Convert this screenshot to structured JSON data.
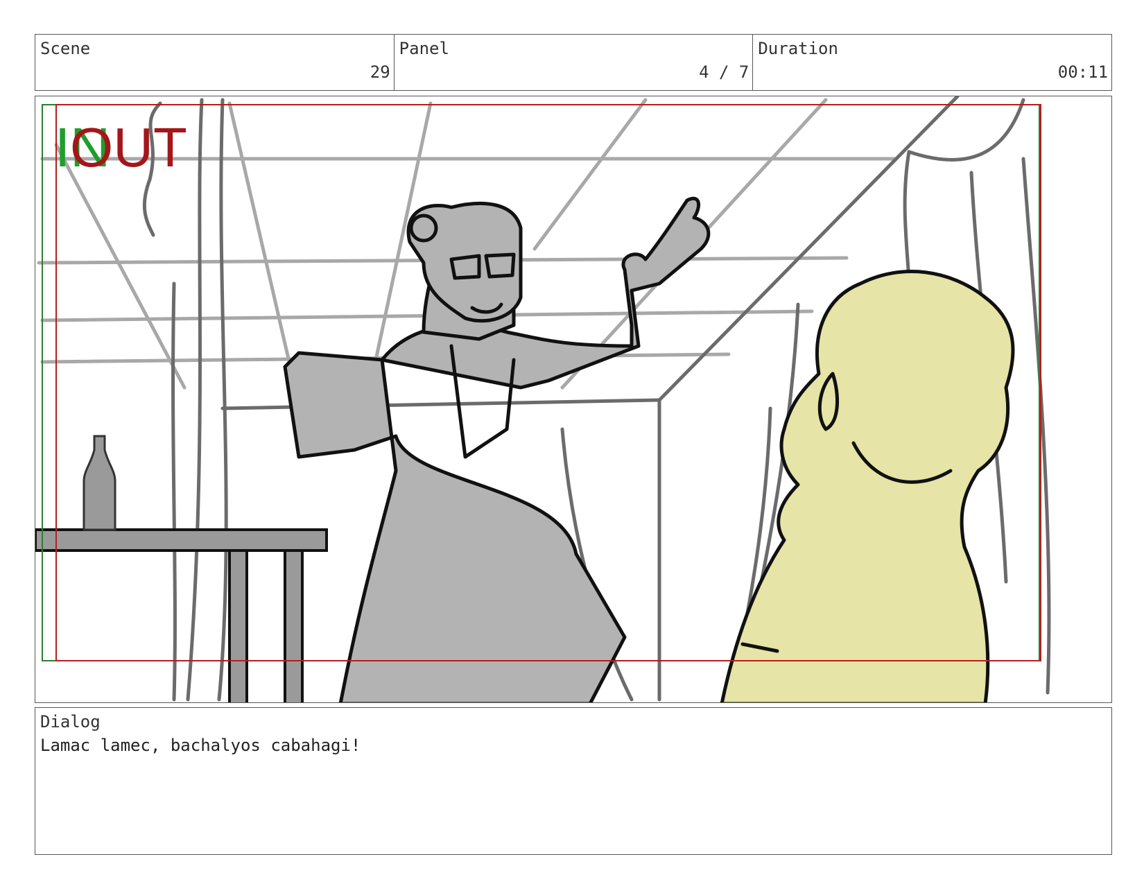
{
  "header": {
    "scene": {
      "label": "Scene",
      "value": "29"
    },
    "panel": {
      "label": "Panel",
      "value": "4 / 7"
    },
    "duration": {
      "label": "Duration",
      "value": "00:11"
    }
  },
  "frame": {
    "marker_in": "IN",
    "marker_out": "OUT",
    "colors": {
      "in_marker": "#1f9e2b",
      "out_marker": "#a3161a",
      "character_fill": "#b3b3b3",
      "child_fill": "#e6e4a6"
    }
  },
  "dialog": {
    "label": "Dialog",
    "text": "Lamac lamec, bachalyos cabahagi!"
  }
}
